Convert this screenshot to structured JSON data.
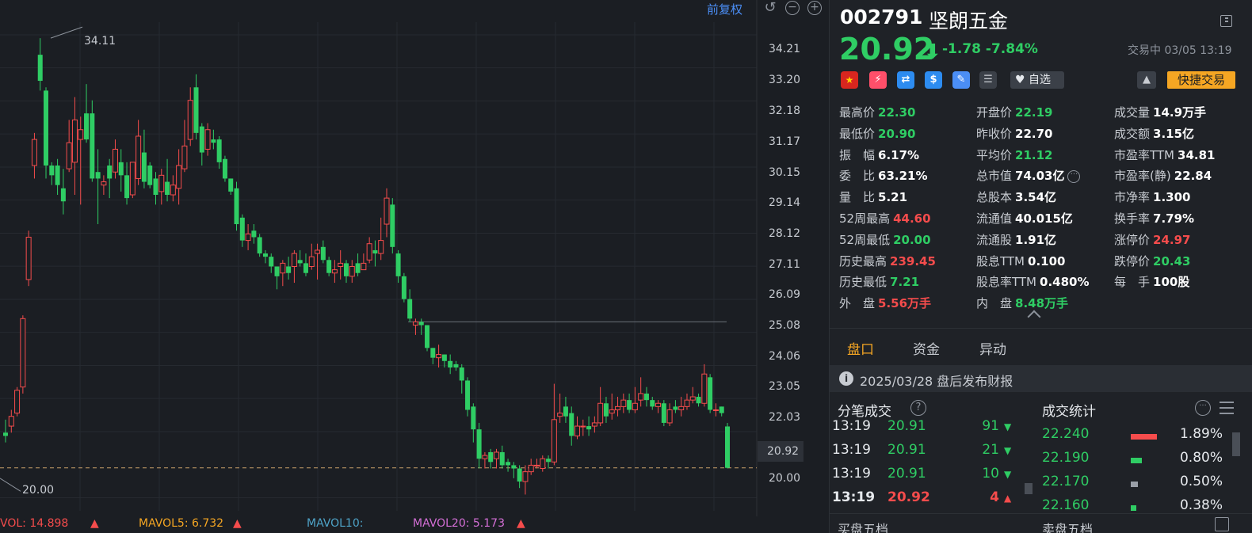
{
  "chart": {
    "adjust_label": "前复权",
    "price_ticks": [
      "34.21",
      "33.20",
      "32.18",
      "31.17",
      "30.15",
      "29.14",
      "28.12",
      "27.11",
      "26.09",
      "25.08",
      "24.06",
      "23.05",
      "22.03",
      "20.00"
    ],
    "last_price_tag": "20.92",
    "high_annotation": "34.11",
    "low_annotation": "20.00",
    "volume_indicators": {
      "vol": "VOL: 14.898",
      "mavol5": "MAVOL5: 6.732",
      "mavol10": "MAVOL10:",
      "mavol20": "MAVOL20: 5.173"
    },
    "colors": {
      "up": "#f54c4c",
      "down": "#2fcd64",
      "ma10": "#4ea3c7",
      "ma20": "#d46fd6",
      "ma5": "#f5a623"
    }
  },
  "chart_data": {
    "type": "candlestick",
    "ylim": [
      19.6,
      34.6
    ],
    "candles": [
      [
        22.0,
        21.9,
        22.4,
        21.7
      ],
      [
        22.2,
        22.5,
        22.7,
        22.0
      ],
      [
        22.6,
        23.3,
        23.4,
        22.5
      ],
      [
        23.4,
        25.5,
        25.6,
        23.2
      ],
      [
        26.7,
        28.0,
        28.2,
        26.5
      ],
      [
        30.2,
        31.0,
        31.2,
        29.8
      ],
      [
        33.6,
        32.8,
        34.11,
        32.5
      ],
      [
        32.5,
        30.2,
        32.6,
        29.8
      ],
      [
        30.2,
        29.9,
        30.3,
        29.6
      ],
      [
        30.2,
        29.6,
        30.4,
        29.3
      ],
      [
        29.5,
        29.1,
        30.1,
        28.7
      ],
      [
        30.1,
        30.9,
        31.6,
        30.0
      ],
      [
        30.3,
        31.6,
        32.3,
        29.3
      ],
      [
        31.0,
        31.3,
        31.7,
        29.0
      ],
      [
        31.8,
        31.0,
        32.7,
        30.9
      ],
      [
        31.8,
        29.8,
        32.2,
        29.7
      ],
      [
        30.0,
        29.8,
        30.7,
        28.4
      ],
      [
        29.6,
        29.7,
        29.9,
        29.3
      ],
      [
        30.2,
        29.8,
        30.4,
        29.2
      ],
      [
        30.0,
        30.7,
        31.0,
        29.8
      ],
      [
        30.3,
        29.9,
        30.7,
        29.4
      ],
      [
        29.9,
        29.2,
        30.3,
        29.0
      ],
      [
        29.3,
        30.3,
        30.3,
        29.2
      ],
      [
        29.8,
        31.1,
        31.6,
        29.6
      ],
      [
        30.6,
        29.7,
        31.3,
        29.5
      ],
      [
        30.2,
        29.6,
        30.3,
        29.5
      ],
      [
        29.8,
        29.3,
        30.0,
        29.0
      ],
      [
        29.4,
        29.9,
        30.1,
        29.0
      ],
      [
        29.7,
        29.3,
        30.4,
        29.1
      ],
      [
        29.3,
        29.6,
        29.9,
        29.1
      ],
      [
        29.5,
        30.2,
        30.7,
        29.0
      ],
      [
        30.1,
        30.8,
        31.6,
        30.0
      ],
      [
        31.0,
        32.2,
        32.6,
        30.8
      ],
      [
        32.6,
        31.2,
        33.0,
        31.0
      ],
      [
        31.4,
        30.6,
        31.5,
        30.2
      ],
      [
        30.7,
        31.3,
        31.5,
        30.5
      ],
      [
        31.0,
        30.9,
        31.3,
        30.7
      ],
      [
        31.0,
        30.3,
        31.1,
        30.1
      ],
      [
        30.4,
        29.8,
        30.5,
        29.7
      ],
      [
        29.8,
        29.4,
        29.8,
        29.3
      ],
      [
        29.5,
        28.4,
        29.7,
        28.2
      ],
      [
        28.6,
        27.9,
        28.7,
        27.7
      ],
      [
        27.9,
        28.1,
        28.4,
        27.6
      ],
      [
        28.2,
        28.0,
        28.4,
        27.8
      ],
      [
        28.0,
        27.5,
        28.1,
        27.4
      ],
      [
        27.5,
        27.4,
        27.6,
        27.2
      ],
      [
        27.4,
        27.1,
        27.5,
        26.9
      ],
      [
        27.1,
        26.8,
        27.1,
        26.4
      ],
      [
        26.9,
        27.2,
        27.3,
        26.5
      ],
      [
        27.1,
        26.9,
        27.4,
        26.7
      ],
      [
        27.1,
        27.5,
        27.6,
        26.6
      ],
      [
        27.3,
        27.2,
        27.6,
        27.1
      ],
      [
        27.2,
        26.9,
        27.5,
        26.8
      ],
      [
        27.1,
        27.4,
        27.8,
        27.0
      ],
      [
        27.5,
        27.6,
        27.8,
        26.7
      ],
      [
        27.7,
        27.3,
        27.9,
        27.2
      ],
      [
        27.3,
        26.9,
        27.4,
        26.8
      ],
      [
        26.9,
        27.0,
        27.3,
        26.6
      ],
      [
        27.1,
        27.2,
        27.6,
        26.7
      ],
      [
        27.2,
        26.8,
        27.3,
        26.6
      ],
      [
        26.8,
        27.1,
        27.3,
        26.6
      ],
      [
        27.2,
        26.9,
        27.5,
        26.8
      ],
      [
        27.0,
        27.2,
        27.5,
        27.0
      ],
      [
        27.3,
        27.8,
        28.0,
        27.2
      ],
      [
        27.6,
        27.5,
        27.9,
        27.1
      ],
      [
        27.5,
        27.9,
        28.6,
        27.3
      ],
      [
        28.4,
        29.2,
        29.5,
        28.0
      ],
      [
        29.0,
        27.7,
        29.2,
        27.5
      ],
      [
        27.5,
        26.8,
        27.6,
        26.6
      ],
      [
        26.8,
        26.1,
        26.9,
        26.0
      ],
      [
        26.1,
        25.5,
        26.4,
        25.4
      ],
      [
        25.3,
        25.4,
        25.5,
        25.0
      ],
      [
        25.4,
        25.3,
        25.5,
        25.0
      ],
      [
        25.3,
        24.6,
        25.3,
        24.5
      ],
      [
        24.6,
        24.3,
        24.6,
        24.1
      ],
      [
        24.3,
        24.4,
        24.7,
        24.0
      ],
      [
        24.4,
        24.2,
        24.4,
        24.0
      ],
      [
        24.2,
        24.0,
        24.4,
        23.8
      ],
      [
        24.1,
        24.0,
        24.2,
        23.9
      ],
      [
        24.0,
        23.6,
        24.1,
        23.2
      ],
      [
        23.6,
        22.7,
        23.7,
        22.5
      ],
      [
        22.8,
        22.1,
        22.9,
        21.7
      ],
      [
        22.1,
        21.2,
        22.3,
        20.9
      ],
      [
        21.2,
        21.3,
        21.4,
        20.9
      ],
      [
        21.4,
        21.1,
        21.5,
        20.9
      ],
      [
        21.2,
        21.4,
        21.5,
        20.9
      ],
      [
        21.4,
        21.0,
        21.6,
        20.9
      ],
      [
        21.1,
        21.0,
        21.2,
        20.8
      ],
      [
        21.0,
        20.9,
        21.1,
        20.6
      ],
      [
        20.9,
        20.5,
        21.0,
        20.3
      ],
      [
        20.5,
        20.8,
        21.0,
        20.1
      ],
      [
        20.8,
        21.0,
        21.2,
        20.7
      ],
      [
        21.0,
        21.0,
        21.2,
        20.9
      ],
      [
        20.9,
        21.2,
        21.3,
        20.8
      ],
      [
        21.2,
        21.1,
        21.3,
        20.9
      ],
      [
        21.1,
        22.4,
        23.5,
        21.0
      ],
      [
        22.5,
        22.6,
        23.2,
        22.3
      ],
      [
        22.8,
        22.5,
        23.1,
        22.3
      ],
      [
        22.6,
        21.9,
        22.8,
        21.6
      ],
      [
        21.9,
        22.2,
        22.5,
        21.8
      ],
      [
        22.2,
        22.2,
        22.4,
        21.9
      ],
      [
        22.2,
        22.1,
        22.5,
        21.9
      ],
      [
        22.2,
        22.3,
        22.5,
        22.0
      ],
      [
        22.3,
        22.9,
        23.4,
        22.2
      ],
      [
        22.9,
        22.5,
        23.1,
        22.3
      ],
      [
        22.6,
        22.7,
        23.2,
        22.4
      ],
      [
        22.7,
        22.8,
        23.1,
        22.5
      ],
      [
        22.8,
        23.0,
        23.2,
        22.6
      ],
      [
        23.0,
        22.7,
        23.2,
        22.6
      ],
      [
        22.7,
        22.9,
        23.4,
        22.6
      ],
      [
        23.0,
        23.2,
        23.7,
        22.8
      ],
      [
        23.2,
        23.0,
        23.4,
        22.8
      ],
      [
        23.0,
        22.8,
        23.1,
        22.7
      ],
      [
        22.8,
        22.9,
        23.0,
        22.6
      ],
      [
        22.9,
        22.3,
        23.0,
        22.2
      ],
      [
        22.3,
        22.7,
        22.9,
        22.2
      ],
      [
        22.8,
        22.7,
        23.0,
        22.6
      ],
      [
        22.7,
        22.8,
        23.1,
        22.5
      ],
      [
        22.8,
        23.0,
        23.2,
        22.7
      ],
      [
        23.0,
        23.1,
        23.4,
        22.9
      ],
      [
        23.1,
        22.9,
        23.2,
        22.8
      ],
      [
        22.9,
        23.8,
        24.1,
        22.8
      ],
      [
        23.7,
        22.7,
        23.8,
        22.6
      ],
      [
        22.7,
        22.7,
        22.9,
        22.5
      ],
      [
        22.8,
        22.6,
        22.8,
        22.5
      ],
      [
        22.19,
        20.92,
        22.3,
        20.9
      ]
    ],
    "reference_lines": [
      {
        "label": "line",
        "value": 25.4
      },
      {
        "label": "last",
        "value": 20.92
      }
    ]
  },
  "quote": {
    "code": "002791",
    "name": "坚朗五金",
    "price": "20.92",
    "arrow": "⬇",
    "change": "-1.78 -7.84%",
    "status": "交易中 03/05 13:19",
    "icons": [
      "china-flag",
      "margin",
      "connect",
      "dollar",
      "tag",
      "document"
    ],
    "flag_text": "★",
    "margin_text": "⚡",
    "connect_text": "⇄",
    "dollar_text": "$",
    "tag_text": "✎",
    "doc_text": "☰",
    "watch_label": "♥ 自选",
    "bell": "🔔",
    "quick_trade": "快捷交易"
  },
  "stats": {
    "col1": [
      {
        "k": "最高价",
        "v": "22.30",
        "c": "green"
      },
      {
        "k": "最低价",
        "v": "20.90",
        "c": "green"
      },
      {
        "k": "振　幅",
        "v": "6.17%",
        "c": "white"
      },
      {
        "k": "委　比",
        "v": "63.21%",
        "c": "white"
      },
      {
        "k": "量　比",
        "v": "5.21",
        "c": "white"
      },
      {
        "k": "52周最高",
        "v": "44.60",
        "c": "red"
      },
      {
        "k": "52周最低",
        "v": "20.00",
        "c": "green"
      },
      {
        "k": "历史最高",
        "v": "239.45",
        "c": "red"
      },
      {
        "k": "历史最低",
        "v": "7.21",
        "c": "green"
      },
      {
        "k": "外　盘",
        "v": "5.56万手",
        "c": "red"
      }
    ],
    "col2": [
      {
        "k": "开盘价",
        "v": "22.19",
        "c": "green"
      },
      {
        "k": "昨收价",
        "v": "22.70",
        "c": "white"
      },
      {
        "k": "平均价",
        "v": "21.12",
        "c": "green"
      },
      {
        "k": "总市值",
        "v": "74.03亿",
        "c": "white"
      },
      {
        "k": "总股本",
        "v": "3.54亿",
        "c": "white"
      },
      {
        "k": "流通值",
        "v": "40.015亿",
        "c": "white"
      },
      {
        "k": "流通股",
        "v": "1.91亿",
        "c": "white"
      },
      {
        "k": "股息TTM",
        "v": "0.100",
        "c": "white"
      },
      {
        "k": "股息率TTM",
        "v": "0.480%",
        "c": "white"
      },
      {
        "k": "内　盘",
        "v": "8.48万手",
        "c": "green"
      }
    ],
    "col3": [
      {
        "k": "成交量",
        "v": "14.9万手",
        "c": "white"
      },
      {
        "k": "成交额",
        "v": "3.15亿",
        "c": "white"
      },
      {
        "k": "市盈率TTM",
        "v": "34.81",
        "c": "white"
      },
      {
        "k": "市盈率(静)",
        "v": "22.84",
        "c": "white"
      },
      {
        "k": "市净率",
        "v": "1.300",
        "c": "white"
      },
      {
        "k": "换手率",
        "v": "7.79%",
        "c": "white"
      },
      {
        "k": "涨停价",
        "v": "24.97",
        "c": "red"
      },
      {
        "k": "跌停价",
        "v": "20.43",
        "c": "green"
      },
      {
        "k": "每　手",
        "v": "100股",
        "c": "white"
      }
    ],
    "more_icon": "···"
  },
  "tabs": [
    "盘口",
    "资金",
    "异动"
  ],
  "notice": {
    "icon": "i",
    "text": "2025/03/28  盘后发布财报"
  },
  "ticks_panel": {
    "title": "分笔成交",
    "help": "?",
    "rows": [
      {
        "time": "13:19",
        "price": "20.91",
        "vol": "91",
        "dir": "down"
      },
      {
        "time": "13:19",
        "price": "20.91",
        "vol": "21",
        "dir": "down"
      },
      {
        "time": "13:19",
        "price": "20.91",
        "vol": "10",
        "dir": "down"
      },
      {
        "time": "13:19",
        "price": "20.92",
        "vol": "4",
        "dir": "up"
      }
    ]
  },
  "dist_panel": {
    "title": "成交统计",
    "more": "···",
    "rows": [
      {
        "price": "22.240",
        "pct": "1.89%",
        "share": 0.0189,
        "color": "#f54c4c"
      },
      {
        "price": "22.190",
        "pct": "0.80%",
        "share": 0.008,
        "color": "#2fcd64"
      },
      {
        "price": "22.170",
        "pct": "0.50%",
        "share": 0.005,
        "color": "#9aa0a8"
      },
      {
        "price": "22.160",
        "pct": "0.38%",
        "share": 0.0038,
        "color": "#2fcd64"
      }
    ]
  },
  "bottom_tabs": [
    "买盘五档",
    "卖盘五档"
  ]
}
